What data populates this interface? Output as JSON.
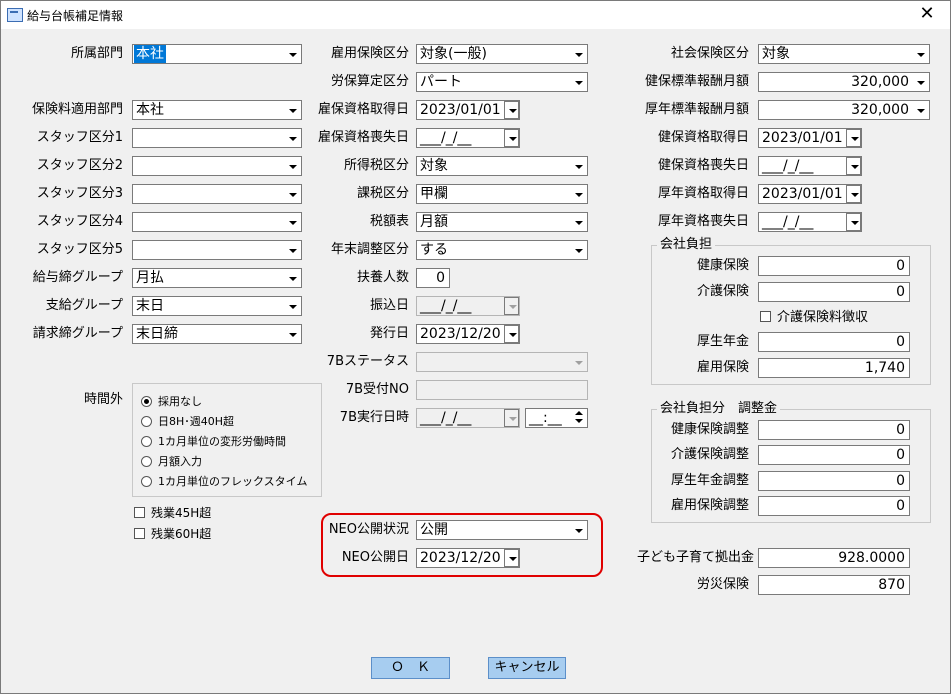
{
  "window": {
    "title": "給与台帳補足情報",
    "close": "✕"
  },
  "col1": {
    "labels": [
      "所属部門",
      "保険料適用部門",
      "スタッフ区分1",
      "スタッフ区分2",
      "スタッフ区分3",
      "スタッフ区分4",
      "スタッフ区分5",
      "給与締グループ",
      "支給グループ",
      "請求締グループ"
    ],
    "values": [
      "本社",
      "本社",
      "",
      "",
      "",
      "",
      "",
      "月払",
      "末日",
      "末日締"
    ]
  },
  "overtime": {
    "label": "時間外",
    "options": [
      "採用なし",
      "日8H･週40H超",
      "1カ月単位の変形労働時間",
      "月額入力",
      "1カ月単位のフレックスタイム"
    ],
    "selected_index": 0,
    "checks": [
      "残業45H超",
      "残業60H超"
    ]
  },
  "col2": {
    "labels": [
      "雇用保険区分",
      "労保算定区分",
      "雇保資格取得日",
      "雇保資格喪失日",
      "所得税区分",
      "課税区分",
      "税額表",
      "年末調整区分",
      "扶養人数",
      "振込日",
      "発行日",
      "7Bステータス",
      "7B受付NO",
      "7B実行日時"
    ],
    "values": [
      "対象(一般)",
      "パート",
      "2023/01/01",
      "___/_/__",
      "対象",
      "甲欄",
      "月額",
      "する",
      "0",
      "___/_/__",
      "2023/12/20",
      "",
      "",
      "___/_/__"
    ],
    "time_value": "__:__"
  },
  "neo": {
    "status_label": "NEO公開状況",
    "status_value": "公開",
    "date_label": "NEO公開日",
    "date_value": "2023/12/20"
  },
  "col3": {
    "labels": [
      "社会保険区分",
      "健保標準報酬月額",
      "厚年標準報酬月額",
      "健保資格取得日",
      "健保資格喪失日",
      "厚年資格取得日",
      "厚年資格喪失日"
    ],
    "values": [
      "対象",
      "320,000",
      "320,000",
      "2023/01/01",
      "___/_/__",
      "2023/01/01",
      "___/_/__"
    ]
  },
  "company_burden": {
    "title": "会社負担",
    "labels": [
      "健康保険",
      "介護保険",
      "厚生年金",
      "雇用保険"
    ],
    "values": [
      "0",
      "0",
      "0",
      "1,740"
    ],
    "check_label": "介護保険料徴収"
  },
  "company_adjust": {
    "title": "会社負担分　調整金",
    "labels": [
      "健康保険調整",
      "介護保険調整",
      "厚生年金調整",
      "雇用保険調整"
    ],
    "values": [
      "0",
      "0",
      "0",
      "0"
    ]
  },
  "childcare": {
    "label": "子ども子育て拠出金",
    "value": "928.0000"
  },
  "workers_comp": {
    "label": "労災保険",
    "value": "870"
  },
  "buttons": {
    "ok": "Ｏ　Ｋ",
    "cancel": "キャンセル"
  }
}
